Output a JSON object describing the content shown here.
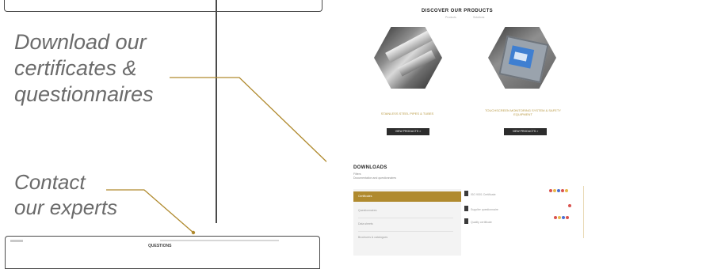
{
  "callouts": {
    "download": {
      "line1": "Download our",
      "line2": "certificates &",
      "line3": "questionnaires"
    },
    "contact": {
      "line1": "Contact",
      "line2": "our experts"
    }
  },
  "thumbnail_bottom": {
    "title": "QUESTIONS"
  },
  "site": {
    "section_title": "DISCOVER OUR PRODUCTS",
    "section_sub_left": "Products",
    "section_sub_right": "Solutions",
    "products": [
      {
        "name": "STAINLESS STEEL PIPES & TUBES",
        "button": "VIEW PRODUCTS >"
      },
      {
        "name": "TOUCHSCREEN MONITORING SYSTEM & SAFETY EQUIPMENT",
        "button": "VIEW PRODUCTS >"
      }
    ],
    "downloads": {
      "title": "DOWNLOADS",
      "sub1": "Filters",
      "sub2": "Documentation and questionnaires",
      "categories": [
        {
          "label": "Certificates"
        },
        {
          "label": "Questionnaires"
        },
        {
          "label": "Data sheets"
        },
        {
          "label": "Brochures & catalogues"
        }
      ],
      "files": [
        {
          "label": "ISO 9001 Certificate"
        },
        {
          "label": "Supplier questionnaire"
        },
        {
          "label": "Quality certificate"
        }
      ]
    }
  },
  "colors": {
    "accent_gold": "#b08a2e",
    "button_dark": "#2c2c2c",
    "text_gray": "#6b6b6b"
  }
}
